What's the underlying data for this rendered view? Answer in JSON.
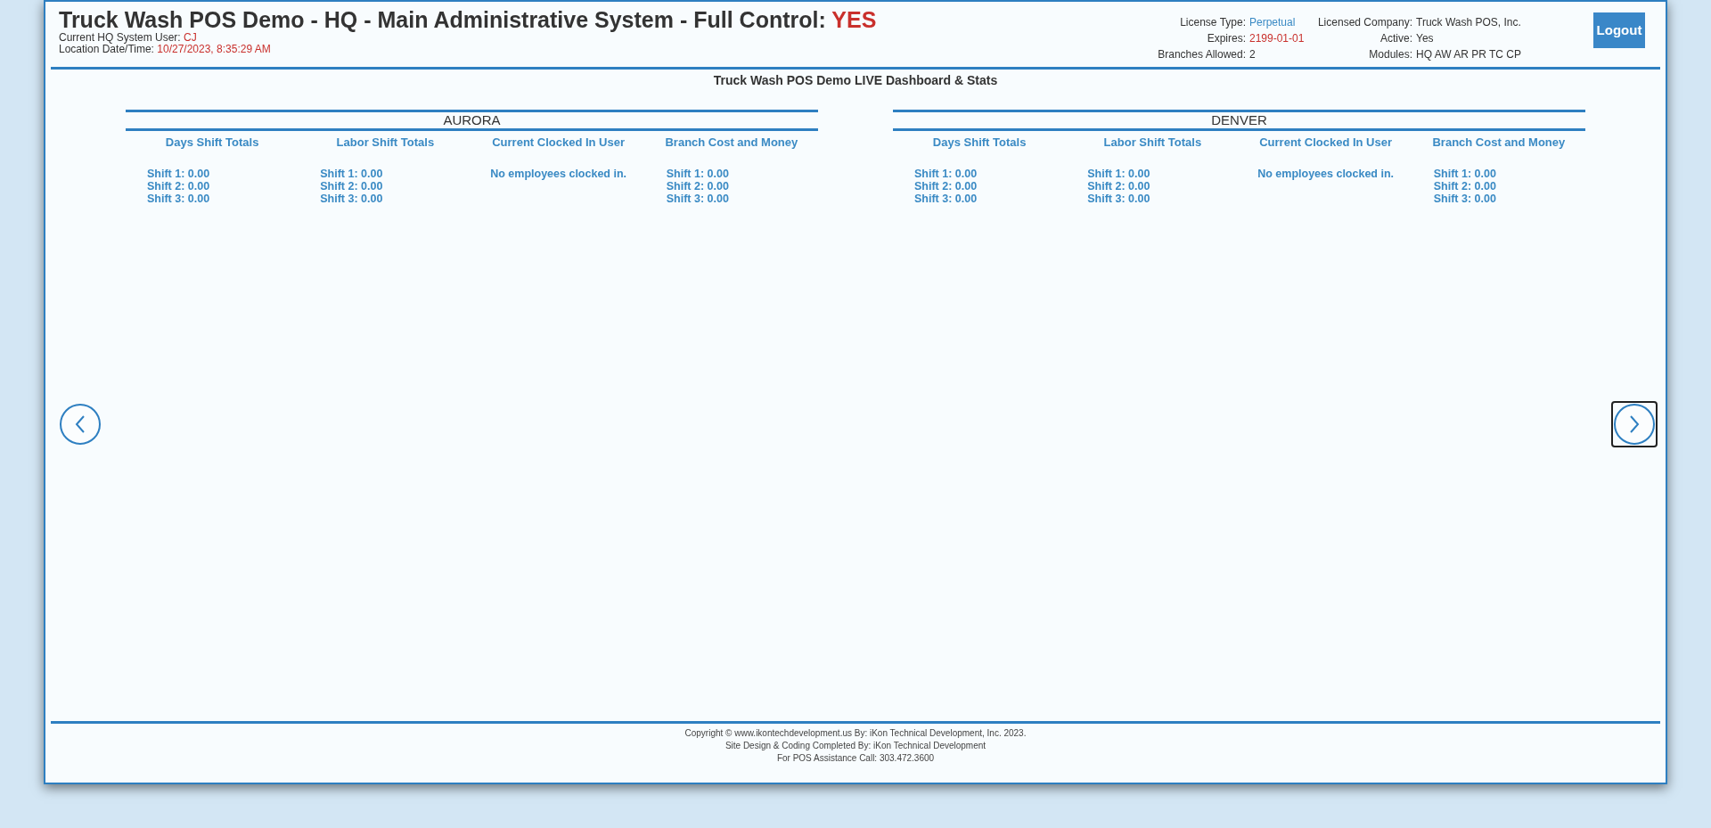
{
  "header": {
    "title": "Truck Wash POS Demo - HQ - Main Administrative System - Full Control:",
    "title_value": "YES",
    "user_label": "Current HQ System User:",
    "user_value": "CJ",
    "datetime_label": "Location Date/Time:",
    "datetime_value": "10/27/2023, 8:35:29 AM"
  },
  "license": [
    {
      "label": "License Type:",
      "value": "Perpetual",
      "color": "#3a8ac4"
    },
    {
      "label": "Licensed Company:",
      "value": "Truck Wash POS, Inc.",
      "color": "#333333"
    },
    {
      "label": "Expires:",
      "value": "2199-01-01",
      "color": "#c9302c"
    },
    {
      "label": "Active:",
      "value": "Yes",
      "color": "#333333"
    },
    {
      "label": "Branches Allowed:",
      "value": "2",
      "color": "#333333"
    },
    {
      "label": "Modules:",
      "value": "HQ AW AR PR TC CP",
      "color": "#333333"
    }
  ],
  "logout_button": "Logout",
  "dashboard_title": "Truck Wash POS Demo LIVE Dashboard & Stats",
  "branches": [
    {
      "name": "AURORA",
      "columns": [
        {
          "heading": "Days Shift Totals",
          "kind": "shifts",
          "lines": [
            "Shift 1: 0.00",
            "Shift 2: 0.00",
            "Shift 3: 0.00"
          ]
        },
        {
          "heading": "Labor Shift Totals",
          "kind": "shifts",
          "lines": [
            "Shift 1: 0.00",
            "Shift 2: 0.00",
            "Shift 3: 0.00"
          ]
        },
        {
          "heading": "Current Clocked In User",
          "kind": "message",
          "text": "No employees clocked in."
        },
        {
          "heading": "Branch Cost and Money",
          "kind": "shifts",
          "lines": [
            "Shift 1: 0.00",
            "Shift 2: 0.00",
            "Shift 3: 0.00"
          ]
        }
      ]
    },
    {
      "name": "DENVER",
      "columns": [
        {
          "heading": "Days Shift Totals",
          "kind": "shifts",
          "lines": [
            "Shift 1: 0.00",
            "Shift 2: 0.00",
            "Shift 3: 0.00"
          ]
        },
        {
          "heading": "Labor Shift Totals",
          "kind": "shifts",
          "lines": [
            "Shift 1: 0.00",
            "Shift 2: 0.00",
            "Shift 3: 0.00"
          ]
        },
        {
          "heading": "Current Clocked In User",
          "kind": "message",
          "text": "No employees clocked in."
        },
        {
          "heading": "Branch Cost and Money",
          "kind": "shifts",
          "lines": [
            "Shift 1: 0.00",
            "Shift 2: 0.00",
            "Shift 3: 0.00"
          ]
        }
      ]
    }
  ],
  "carousel": {
    "prev_focused": false,
    "next_focused": true
  },
  "footer": [
    "Copyright © www.ikontechdevelopment.us By: iKon Technical Development, Inc. 2023.",
    "Site Design & Coding Completed By: iKon Technical Development",
    "For POS Assistance Call: 303.472.3600"
  ]
}
